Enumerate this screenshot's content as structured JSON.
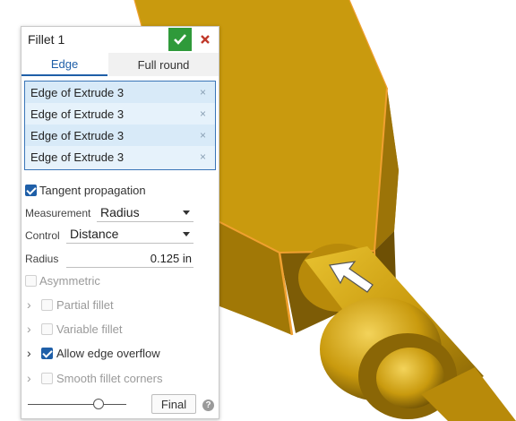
{
  "panel": {
    "title": "Fillet 1",
    "ok_icon": "check-icon",
    "cancel_icon": "close-icon",
    "tabs": [
      {
        "label": "Edge",
        "active": true
      },
      {
        "label": "Full round",
        "active": false
      }
    ],
    "edges": [
      {
        "label": "Edge of Extrude 3",
        "remove": "×"
      },
      {
        "label": "Edge of Extrude 3",
        "remove": "×"
      },
      {
        "label": "Edge of Extrude 3",
        "remove": "×"
      },
      {
        "label": "Edge of Extrude 3",
        "remove": "×"
      }
    ],
    "tangent_propagation": {
      "label": "Tangent propagation",
      "checked": true
    },
    "measurement": {
      "label": "Measurement",
      "value": "Radius"
    },
    "control": {
      "label": "Control",
      "value": "Distance"
    },
    "radius": {
      "label": "Radius",
      "value": "0.125 in"
    },
    "asymmetric": {
      "label": "Asymmetric",
      "checked": false
    },
    "partial_fillet": {
      "label": "Partial fillet",
      "checked": false
    },
    "variable_fillet": {
      "label": "Variable fillet",
      "checked": false
    },
    "allow_edge_overflow": {
      "label": "Allow edge overflow",
      "checked": true
    },
    "smooth_fillet_corners": {
      "label": "Smooth fillet corners",
      "checked": false
    },
    "final_button": "Final",
    "help_icon": "?"
  },
  "colors": {
    "accent": "#1f5fa8",
    "ok": "#2f9a3a",
    "cancel": "#c0392b",
    "part_gold": "#c99a0e",
    "selection_orange": "#f0a030"
  }
}
